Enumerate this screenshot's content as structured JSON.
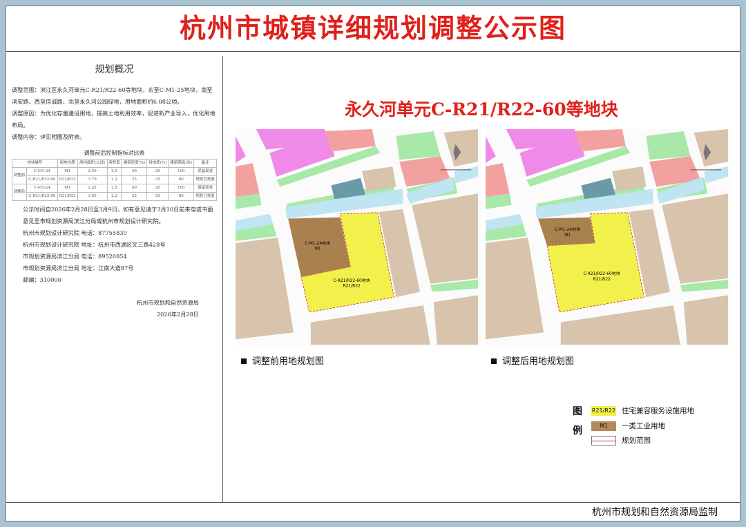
{
  "title": "杭州市城镇详细规划调整公示图",
  "subtitle": "永久河单元C-R21/R22-60等地块",
  "left": {
    "heading": "规划概况",
    "paragraphs": [
      "调整范围：滨江区永久河单元C-R21/R22-60等地块，东至C-M1-25地块，南至滨安路、西至信诚路、北至永久河公园绿地，用地面积约6.08公顷。",
      "调整原因：为优化存量建设用地，提高土地利用效率，促进新产业导入，优化用地布局。",
      "调整内容：详见附图及附表。"
    ],
    "table_title": "调整前后控制指标对比表",
    "table_headers": [
      "地块编号",
      "用地性质",
      "用地面积(公顷)",
      "容积率",
      "建筑密度(%)",
      "绿地率(%)",
      "建筑限高(米)",
      "备注"
    ],
    "table_rows": [
      {
        "group": "调整前",
        "cells": [
          "C-M1-24",
          "M1",
          "2.59",
          "2.5",
          "40",
          "20",
          "100",
          "保留现状"
        ]
      },
      {
        "group": "",
        "cells": [
          "C-R21/R22-60",
          "R21/R22",
          "3.79",
          "2.2",
          "25",
          "25",
          "80",
          "规划已批复"
        ]
      },
      {
        "group": "调整后",
        "cells": [
          "C-M1-24",
          "M1",
          "2.32",
          "2.5",
          "40",
          "20",
          "100",
          "保留现状"
        ]
      },
      {
        "group": "",
        "cells": [
          "C-R21/R22-60",
          "R21/R22",
          "3.05",
          "2.2",
          "25",
          "25",
          "80",
          "规划已批复"
        ]
      }
    ],
    "notice": "公示时间自2026年2月28日至3月9日，如有意见请于3月10日前来电或书面意见至市规划资源局滨江分局或杭州市规划设计研究院。",
    "contacts": [
      "杭州市规划设计研究院  电话：87755830",
      "杭州市规划设计研究院  地址：杭州市西湖区文三路428号",
      "市规划资源局滨江分局  电话：89520854",
      "市规划资源局滨江分局  地址：江南大道87号",
      "邮编：310000"
    ],
    "signature": "杭州市规划和自然资源局",
    "date": "2026年2月28日"
  },
  "maps": [
    {
      "caption": "调整前用地规划图",
      "m1_label": "C-M1-24地块",
      "m1_code": "M1",
      "r_label": "C-R21/R22-60地块",
      "r_code": "R21/R22"
    },
    {
      "caption": "调整后用地规划图",
      "m1_label": "C-M1-24地块",
      "m1_code": "M1",
      "r_label": "C-R21/R22-60地块",
      "r_code": "R21/R22"
    }
  ],
  "legend": {
    "heading_1": "图",
    "heading_2": "例",
    "items": [
      {
        "code": "R21/R22",
        "label": "住宅兼容服务设施用地",
        "color": "#f2f04a"
      },
      {
        "code": "M1",
        "label": "一类工业用地",
        "color": "#b38a5a"
      },
      {
        "code": "",
        "label": "规划范围",
        "color": "#e02020"
      }
    ]
  },
  "footer": "杭州市规划和自然资源局监制"
}
